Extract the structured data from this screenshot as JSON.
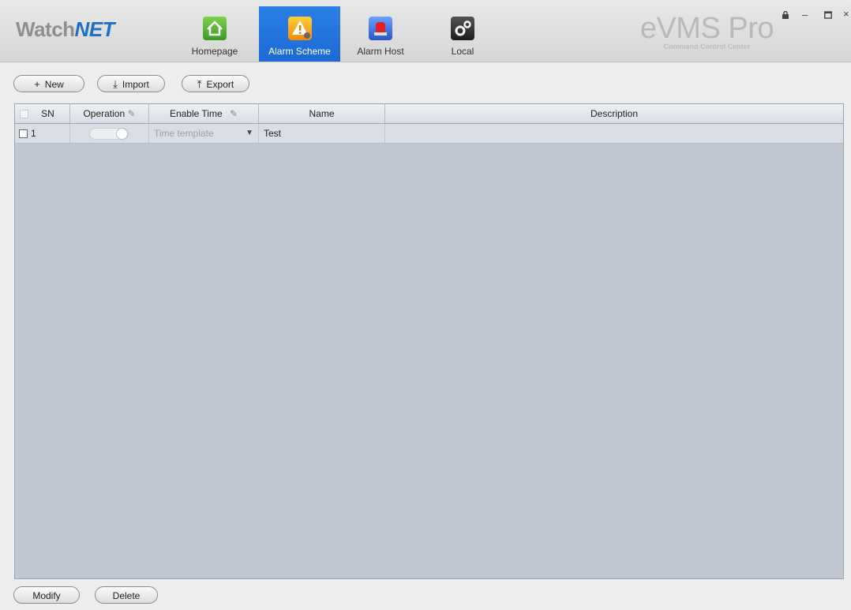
{
  "header": {
    "logo_prefix": "Watch",
    "logo_suffix": "NET",
    "brand_title": "eVMS Pro",
    "brand_subtitle": "Command Control Center",
    "tabs": [
      {
        "label": "Homepage",
        "icon": "home-icon"
      },
      {
        "label": "Alarm Scheme",
        "icon": "alarm-scheme-icon",
        "active": true
      },
      {
        "label": "Alarm Host",
        "icon": "alarm-host-icon"
      },
      {
        "label": "Local",
        "icon": "gear-icon"
      }
    ],
    "window_controls": [
      "lock-icon",
      "minimize-icon",
      "maximize-icon",
      "close-icon"
    ]
  },
  "toolbar": {
    "new_label": "New",
    "import_label": "Import",
    "export_label": "Export"
  },
  "table": {
    "columns": [
      "SN",
      "Operation",
      "Enable Time",
      "Name",
      "Description"
    ],
    "rows": [
      {
        "sn": "1",
        "operation": "off",
        "enable_time": "Time template",
        "name": "Test",
        "description": ""
      }
    ]
  },
  "footer": {
    "modify_label": "Modify",
    "delete_label": "Delete"
  },
  "colors": {
    "active_tab": "#1d6ad4",
    "grid_background": "#c0c7d3"
  }
}
